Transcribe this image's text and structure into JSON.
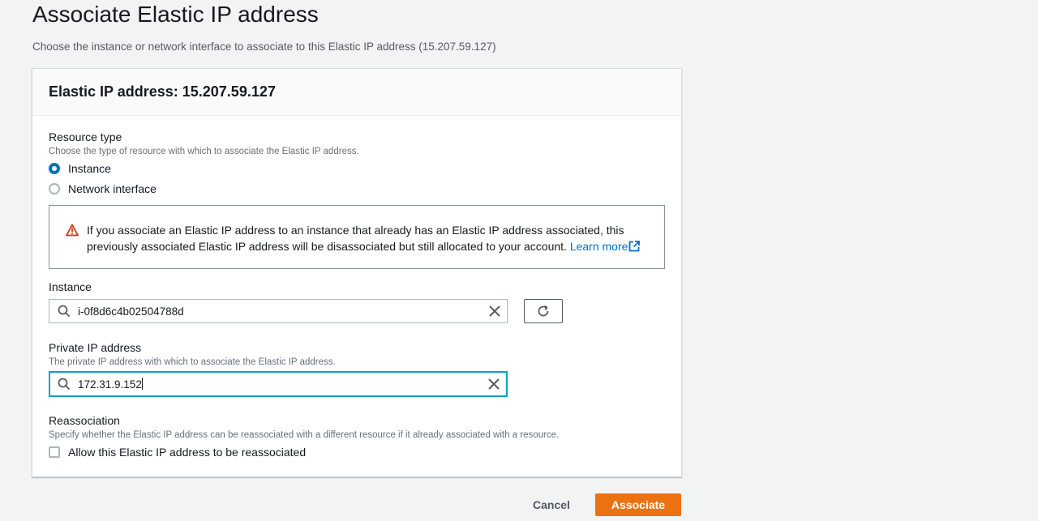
{
  "page": {
    "title": "Associate Elastic IP address",
    "description": "Choose the instance or network interface to associate to this Elastic IP address (15.207.59.127)"
  },
  "panel": {
    "header": "Elastic IP address: 15.207.59.127"
  },
  "resource_type": {
    "label": "Resource type",
    "description": "Choose the type of resource with which to associate the Elastic IP address.",
    "options": [
      {
        "label": "Instance",
        "selected": true
      },
      {
        "label": "Network interface",
        "selected": false
      }
    ]
  },
  "alert": {
    "type": "warning",
    "text": "If you associate an Elastic IP address to an instance that already has an Elastic IP address associated, this previously associated Elastic IP address will be disassociated but still allocated to your account.",
    "link_text": "Learn more",
    "icon": "warning-icon",
    "color": "#d13212"
  },
  "instance": {
    "label": "Instance",
    "value": "i-0f8d6c4b02504788d"
  },
  "private_ip": {
    "label": "Private IP address",
    "description": "The private IP address with which to associate the Elastic IP address.",
    "value": "172.31.9.152"
  },
  "reassociation": {
    "label": "Reassociation",
    "description": "Specify whether the Elastic IP address can be reassociated with a different resource if it already associated with a resource.",
    "checkbox_label": "Allow this Elastic IP address to be reassociated",
    "checked": false
  },
  "actions": {
    "cancel_label": "Cancel",
    "associate_label": "Associate",
    "primary_color": "#ec7211"
  }
}
